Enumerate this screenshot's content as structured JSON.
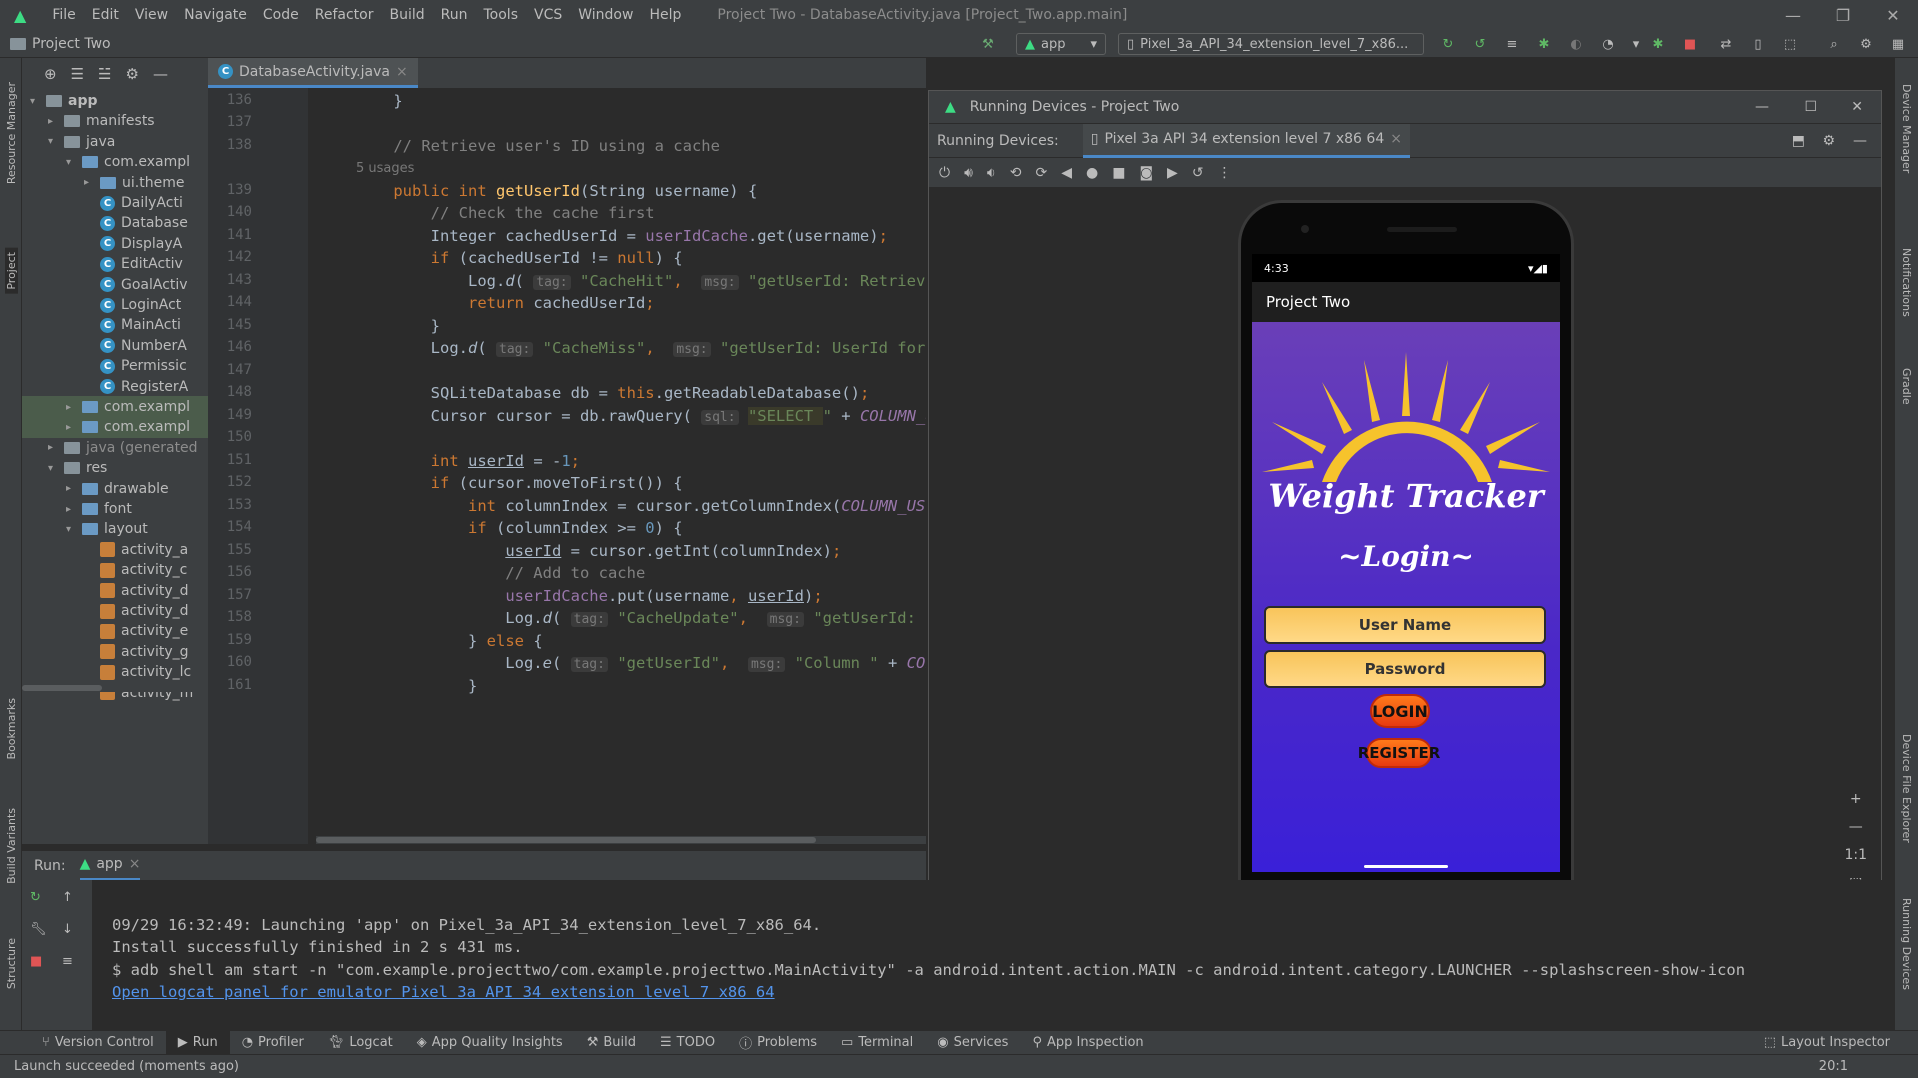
{
  "window": {
    "title": "Project Two - DatabaseActivity.java [Project_Two.app.main]",
    "menu": [
      "File",
      "Edit",
      "View",
      "Navigate",
      "Code",
      "Refactor",
      "Build",
      "Run",
      "Tools",
      "VCS",
      "Window",
      "Help"
    ]
  },
  "navbar": {
    "project": "Project Two",
    "run_config": "app",
    "device": "Pixel_3a_API_34_extension_level_7_x86..."
  },
  "left_strip": [
    "Resource Manager",
    "Project",
    "Bookmarks",
    "Build Variants",
    "Structure"
  ],
  "right_strip": [
    "Device Manager",
    "Notifications",
    "Gradle",
    "Device File Explorer",
    "Running Devices"
  ],
  "project_tree": [
    {
      "label": "app",
      "indent": 0,
      "type": "folder",
      "open": true
    },
    {
      "label": "manifests",
      "indent": 1,
      "type": "folder"
    },
    {
      "label": "java",
      "indent": 1,
      "type": "folder",
      "open": true
    },
    {
      "label": "com.exampl",
      "indent": 2,
      "type": "folder",
      "open": true
    },
    {
      "label": "ui.theme",
      "indent": 3,
      "type": "folder"
    },
    {
      "label": "DailyActi",
      "indent": 3,
      "type": "class"
    },
    {
      "label": "Database",
      "indent": 3,
      "type": "class"
    },
    {
      "label": "DisplayA",
      "indent": 3,
      "type": "class"
    },
    {
      "label": "EditActiv",
      "indent": 3,
      "type": "class"
    },
    {
      "label": "GoalActiv",
      "indent": 3,
      "type": "class"
    },
    {
      "label": "LoginAct",
      "indent": 3,
      "type": "class"
    },
    {
      "label": "MainActi",
      "indent": 3,
      "type": "class"
    },
    {
      "label": "NumberA",
      "indent": 3,
      "type": "class"
    },
    {
      "label": "Permissic",
      "indent": 3,
      "type": "class"
    },
    {
      "label": "RegisterA",
      "indent": 3,
      "type": "class"
    },
    {
      "label": "com.exampl",
      "indent": 2,
      "type": "folder"
    },
    {
      "label": "com.exampl",
      "indent": 2,
      "type": "folder"
    },
    {
      "label": "java (generated",
      "indent": 1,
      "type": "folder"
    },
    {
      "label": "res",
      "indent": 1,
      "type": "folder",
      "open": true
    },
    {
      "label": "drawable",
      "indent": 2,
      "type": "folder"
    },
    {
      "label": "font",
      "indent": 2,
      "type": "folder"
    },
    {
      "label": "layout",
      "indent": 2,
      "type": "folder",
      "open": true
    },
    {
      "label": "activity_a",
      "indent": 3,
      "type": "layout"
    },
    {
      "label": "activity_c",
      "indent": 3,
      "type": "layout"
    },
    {
      "label": "activity_d",
      "indent": 3,
      "type": "layout"
    },
    {
      "label": "activity_d",
      "indent": 3,
      "type": "layout"
    },
    {
      "label": "activity_e",
      "indent": 3,
      "type": "layout"
    },
    {
      "label": "activity_g",
      "indent": 3,
      "type": "layout"
    },
    {
      "label": "activity_lc",
      "indent": 3,
      "type": "layout"
    },
    {
      "label": "activity_m",
      "indent": 3,
      "type": "layout"
    }
  ],
  "editor": {
    "tab": "DatabaseActivity.java",
    "usages": "5 usages",
    "line_numbers": [
      "136",
      "137",
      "138",
      "139",
      "140",
      "141",
      "142",
      "143",
      "144",
      "145",
      "146",
      "147",
      "148",
      "149",
      "150",
      "151",
      "152",
      "153",
      "154",
      "155",
      "156",
      "157",
      "158",
      "159",
      "160",
      "161"
    ]
  },
  "running_devices": {
    "title": "Running Devices - Project Two",
    "label": "Running Devices:",
    "tab": "Pixel 3a API 34 extension level 7 x86 64",
    "zoom_label": "1:1"
  },
  "phone": {
    "time": "4:33",
    "app_title": "Project Two",
    "heading": "Weight Tracker",
    "subheading": "~Login~",
    "username_placeholder": "User Name",
    "password_placeholder": "Password",
    "login": "LOGIN",
    "register": "REGISTER"
  },
  "run_panel": {
    "label": "Run:",
    "config": "app",
    "lines": [
      "09/29 16:32:49: Launching 'app' on Pixel_3a_API_34_extension_level_7_x86_64.",
      "Install successfully finished in 2 s 431 ms.",
      "$ adb shell am start -n \"com.example.projecttwo/com.example.projecttwo.MainActivity\" -a android.intent.action.MAIN -c android.intent.category.LAUNCHER --splashscreen-show-icon"
    ],
    "link": "Open logcat panel for emulator Pixel 3a API 34 extension level 7 x86 64"
  },
  "bottom_tools": [
    "Version Control",
    "Run",
    "Profiler",
    "Logcat",
    "App Quality Insights",
    "Build",
    "TODO",
    "Problems",
    "Terminal",
    "Services",
    "App Inspection"
  ],
  "layout_inspector": "Layout Inspector",
  "status": {
    "message": "Launch succeeded (moments ago)",
    "position": "20:1"
  }
}
